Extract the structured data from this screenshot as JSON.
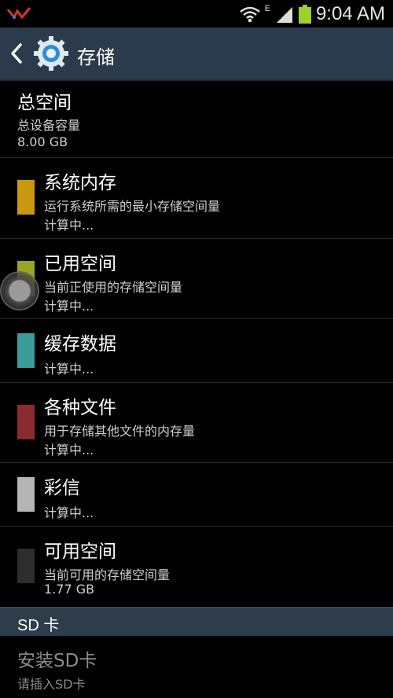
{
  "status_bar": {
    "network_type": "E",
    "time": "9:04 AM"
  },
  "action_bar": {
    "title": "存储"
  },
  "total": {
    "title": "总空间",
    "subtitle": "总设备容量",
    "value": "8.00 GB"
  },
  "items": [
    {
      "title": "系统内存",
      "subtitle": "运行系统所需的最小存储空间量",
      "value": "计算中...",
      "color": "#c9980f"
    },
    {
      "title": "已用空间",
      "subtitle": "当前正使用的存储空间量",
      "value": "计算中...",
      "color": "#9aa621"
    },
    {
      "title": "缓存数据",
      "subtitle": "",
      "value": "计算中...",
      "color": "#3b9c9c"
    },
    {
      "title": "各种文件",
      "subtitle": "用于存储其他文件的内存量",
      "value": "计算中...",
      "color": "#8b2b30"
    },
    {
      "title": "彩信",
      "subtitle": "",
      "value": "计算中...",
      "color": "#b5b5b5"
    },
    {
      "title": "可用空间",
      "subtitle": "当前可用的存储空间量",
      "value": "1.77 GB",
      "color": "#2e2e2e"
    }
  ],
  "sd_section": {
    "header": "SD 卡",
    "install_title": "安装SD卡",
    "install_subtitle": "请插入SD卡"
  }
}
